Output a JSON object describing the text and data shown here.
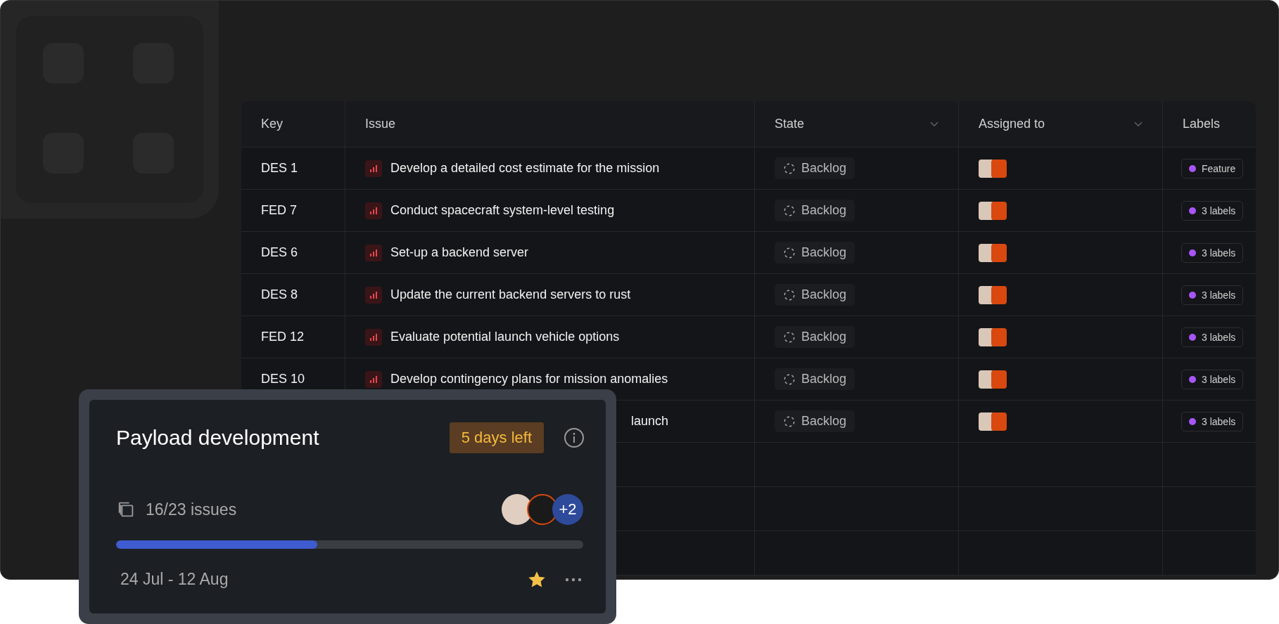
{
  "table": {
    "columns": [
      {
        "label": "Key",
        "sortable": false
      },
      {
        "label": "Issue",
        "sortable": false
      },
      {
        "label": "State",
        "sortable": true
      },
      {
        "label": "Assigned to",
        "sortable": true
      },
      {
        "label": "Labels",
        "sortable": false
      }
    ],
    "rows": [
      {
        "key": "DES 1",
        "issue": "Develop a detailed cost estimate for the mission",
        "state": "Backlog",
        "label": "Feature"
      },
      {
        "key": "FED 7",
        "issue": "Conduct spacecraft system-level testing",
        "state": "Backlog",
        "label": "3 labels"
      },
      {
        "key": "DES 6",
        "issue": "Set-up a backend server",
        "state": "Backlog",
        "label": "3 labels"
      },
      {
        "key": "DES 8",
        "issue": "Update the current backend servers to rust",
        "state": "Backlog",
        "label": "3 labels"
      },
      {
        "key": "FED 12",
        "issue": "Evaluate potential launch vehicle options",
        "state": "Backlog",
        "label": "3 labels"
      },
      {
        "key": "DES 10",
        "issue": "Develop contingency plans for mission anomalies",
        "state": "Backlog",
        "label": "3 labels"
      },
      {
        "kind": "partial",
        "issue": "launch",
        "state": "Backlog",
        "label": "3 labels"
      }
    ]
  },
  "cycle_card": {
    "title": "Payload development",
    "badge": "5 days left",
    "issues": "16/23 issues",
    "extra_members": "+2",
    "level": 0.43,
    "dates": "24 Jul - 12 Aug",
    "starred": true
  }
}
